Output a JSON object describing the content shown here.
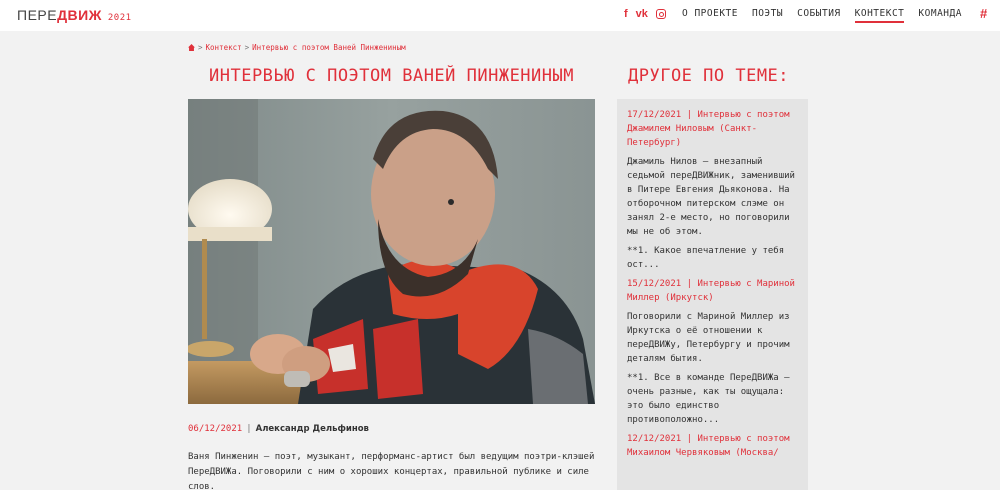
{
  "header": {
    "logo_main": "ПЕРЕ",
    "logo_accent": "ДВИЖ",
    "logo_year": "2021",
    "social": [
      {
        "name": "facebook-icon",
        "glyph": "f"
      },
      {
        "name": "vk-icon",
        "glyph": "vk"
      },
      {
        "name": "instagram-icon",
        "glyph": ""
      }
    ],
    "nav": [
      {
        "label": "О ПРОЕКТЕ",
        "active": false
      },
      {
        "label": "ПОЭТЫ",
        "active": false
      },
      {
        "label": "СОБЫТИЯ",
        "active": false
      },
      {
        "label": "КОНТЕКСТ",
        "active": true
      },
      {
        "label": "КОМАНДА",
        "active": false
      }
    ],
    "hash": "#"
  },
  "breadcrumb": {
    "sep": ">",
    "items": [
      "Контекст",
      "Интервью с поэтом Ваней Пинжениным"
    ]
  },
  "article": {
    "title": "ИНТЕРВЬЮ С ПОЭТОМ ВАНЕЙ ПИНЖЕНИНЫМ",
    "date": "06/12/2021",
    "divider": "|",
    "author": "Александр Дельфинов",
    "lead": "Ваня Пинженин — поэт, музыкант, перформанс-артист был ведущим поэтри-клэшей ПереДВИЖа. Поговорили с ним о хороших концертах, правильной публике и силе слов."
  },
  "sidebar": {
    "title": "ДРУГОЕ ПО ТЕМЕ:",
    "articles": [
      {
        "head": "17/12/2021 | Интервью с поэтом Джамилем Ниловым (Санкт-Петербург)",
        "body": "Джамиль Нилов — внезапный седьмой переДВИЖник, заменивший в Питере Евгения Дьяконова. На отборочном питерском слэме он занял 2-е место, но поговорили мы не об этом.",
        "q": "**1. Какое впечатление у тебя ост..."
      },
      {
        "head": "15/12/2021 | Интервью с Мариной Миллер (Иркутск)",
        "body": "Поговорили с Мариной Миллер из Иркутска о её отношении к переДВИЖу, Петербургу и прочим деталям бытия.",
        "q": "  **1. Все в команде ПереДВИЖа — очень разные, как ты ощущала: это было единство противоположно..."
      },
      {
        "head": "12/12/2021 | Интервью с поэтом Михаилом Червяковым (Москва/",
        "body": "",
        "q": ""
      }
    ]
  },
  "colors": {
    "accent": "#e0303a",
    "background": "#f2f2f2",
    "sidebar": "#e4e4e4"
  }
}
